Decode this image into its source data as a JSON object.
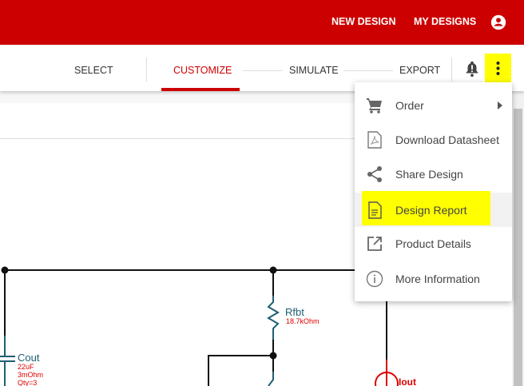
{
  "header": {
    "new_design": "NEW DESIGN",
    "my_designs": "MY DESIGNS"
  },
  "tabs": [
    {
      "label": "SELECT"
    },
    {
      "label": "CUSTOMIZE"
    },
    {
      "label": "SIMULATE"
    },
    {
      "label": "EXPORT"
    }
  ],
  "menu": {
    "items": [
      {
        "label": "Order"
      },
      {
        "label": "Download Datasheet"
      },
      {
        "label": "Share Design"
      },
      {
        "label": "Design Report"
      },
      {
        "label": "Product Details"
      },
      {
        "label": "More Information"
      }
    ]
  },
  "schematic": {
    "rfbt": {
      "name": "Rfbt",
      "value": "18.7kOhm"
    },
    "cout": {
      "name": "Cout",
      "value": "22uF",
      "esr": "3mOhm",
      "qty": "Qty=3"
    },
    "iout": {
      "name": "Iout"
    }
  },
  "colors": {
    "brand": "#cc0000",
    "highlight": "#ffff00",
    "component": "#1f5f73"
  }
}
